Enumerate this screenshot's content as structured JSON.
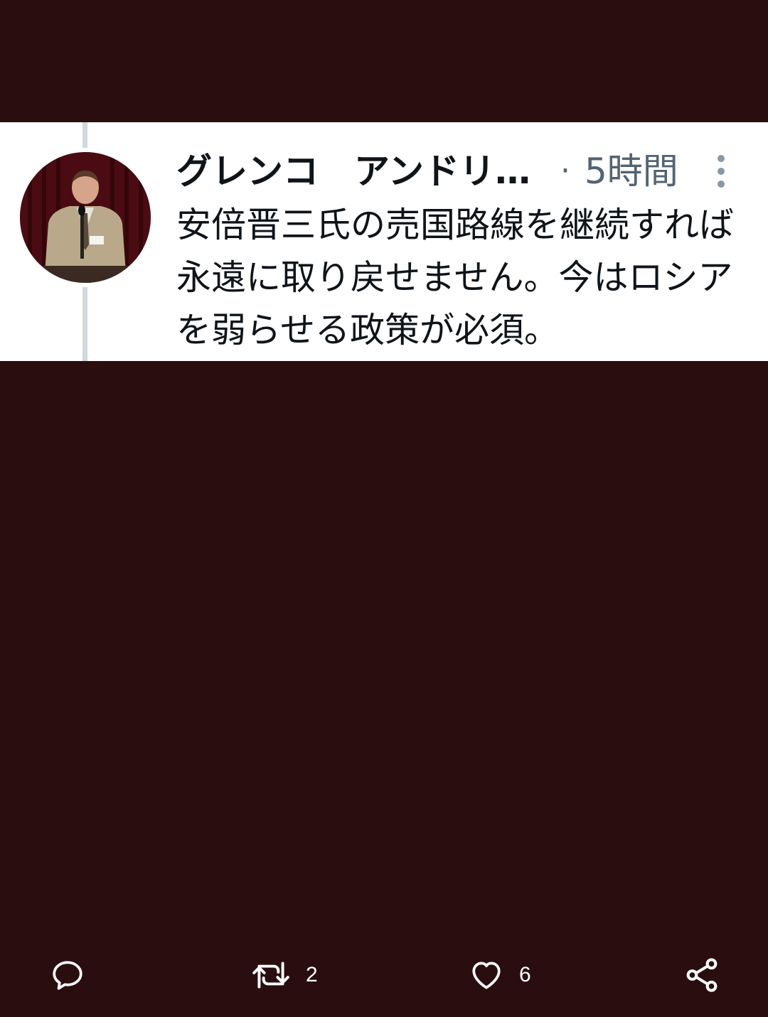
{
  "tweet": {
    "display_name": "グレンコ　アンドリ…",
    "separator": "·",
    "timestamp": "5時間",
    "text": "安倍晋三氏の売国路線を継続すれば永遠に取り戻せません。今はロシアを弱らせる政策が必須。"
  },
  "actions": {
    "reply": {
      "icon": "reply-icon",
      "count": ""
    },
    "retweet": {
      "icon": "retweet-icon",
      "count": "2"
    },
    "like": {
      "icon": "heart-icon",
      "count": "6"
    },
    "share": {
      "icon": "share-icon"
    }
  },
  "colors": {
    "background": "#2a0e0f",
    "card": "#ffffff",
    "text_primary": "#0f1419",
    "text_secondary": "#536471",
    "thread_line": "#cfd9de",
    "action_icons": "#ffffff"
  }
}
